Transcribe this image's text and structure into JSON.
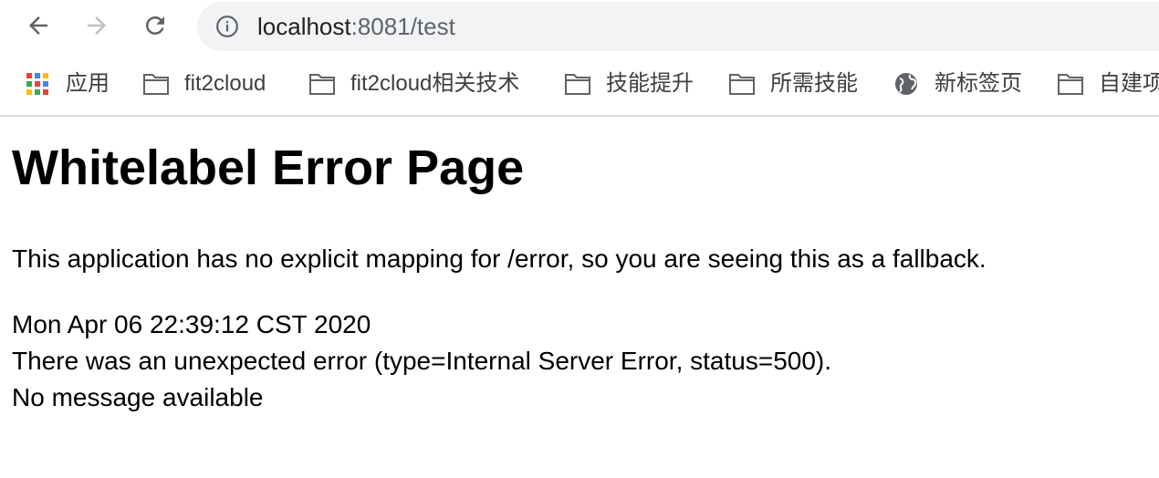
{
  "toolbar": {
    "back_icon": "arrow-left-icon",
    "forward_icon": "arrow-right-icon",
    "reload_icon": "reload-icon",
    "site_info_icon": "info-icon",
    "url_host": "localhost",
    "url_path": ":8081/test"
  },
  "bookmarks": [
    {
      "icon": "apps-grid-icon",
      "label": "应用"
    },
    {
      "icon": "folder-icon",
      "label": "fit2cloud"
    },
    {
      "icon": "folder-icon",
      "label": "fit2cloud相关技术"
    },
    {
      "icon": "folder-icon",
      "label": "技能提升"
    },
    {
      "icon": "folder-icon",
      "label": "所需技能"
    },
    {
      "icon": "globe-icon",
      "label": "新标签页"
    },
    {
      "icon": "folder-icon",
      "label": "自建项"
    }
  ],
  "page": {
    "title": "Whitelabel Error Page",
    "description": "This application has no explicit mapping for /error, so you are seeing this as a fallback.",
    "timestamp": "Mon Apr 06 22:39:12 CST 2020",
    "error_line": "There was an unexpected error (type=Internal Server Error, status=500).",
    "message": "No message available"
  },
  "colors": {
    "omnibox_bg": "#f1f3f4",
    "icon_gray": "#5f6368",
    "disabled_gray": "#bdc1c6",
    "divider": "#dadce0"
  }
}
